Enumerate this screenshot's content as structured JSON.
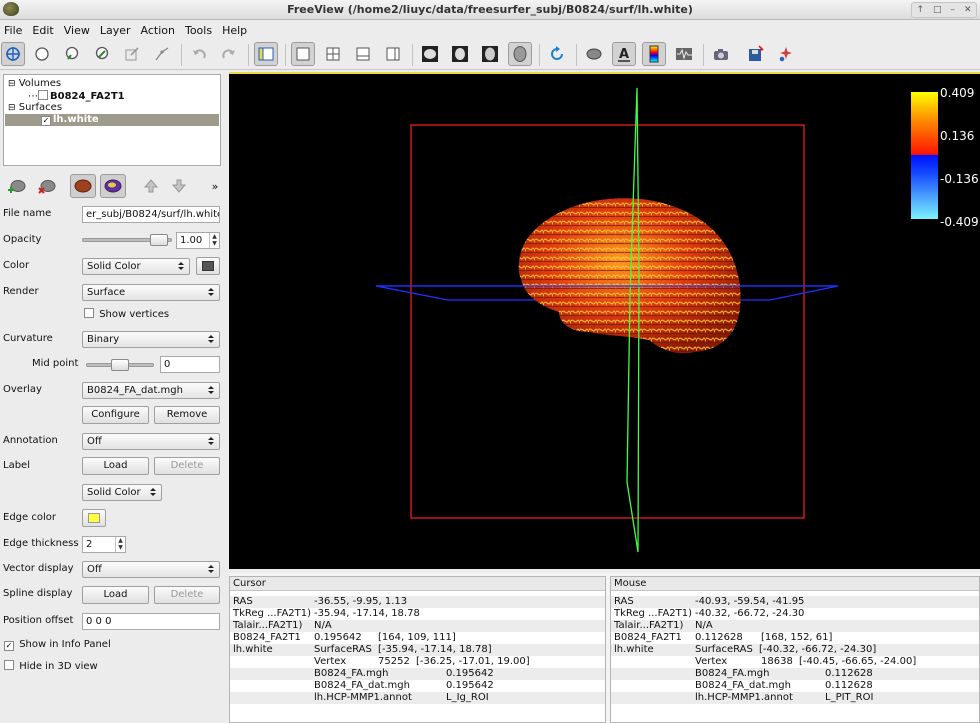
{
  "window": {
    "title": "FreeView (/home2/liuyc/data/freesurfer_subj/B0824/surf/lh.white)"
  },
  "menu": [
    "File",
    "Edit",
    "View",
    "Layer",
    "Action",
    "Tools",
    "Help"
  ],
  "layers": {
    "volumes_label": "Volumes",
    "volume_item": "B0824_FA2T1",
    "surfaces_label": "Surfaces",
    "surface_item": "lh.white"
  },
  "props": {
    "file_name_label": "File name",
    "file_name_value": "er_subj/B0824/surf/lh.white",
    "opacity_label": "Opacity",
    "opacity_value": "1.00",
    "opacity_level": 0.95,
    "color_label": "Color",
    "color_mode": "Solid Color",
    "render_label": "Render",
    "render_value": "Surface",
    "show_vertices": "Show vertices",
    "curvature_label": "Curvature",
    "curvature_value": "Binary",
    "midpoint_label": "Mid point",
    "midpoint_value": "0",
    "midpoint_level": 0.5,
    "overlay_label": "Overlay",
    "overlay_value": "B0824_FA_dat.mgh",
    "configure_btn": "Configure",
    "remove_btn": "Remove",
    "annotation_label": "Annotation",
    "annotation_value": "Off",
    "label_label": "Label",
    "load_btn": "Load",
    "delete_btn": "Delete",
    "label_color_mode": "Solid Color",
    "edge_color_label": "Edge color",
    "edge_thickness_label": "Edge thickness",
    "edge_thickness_value": "2",
    "vector_label": "Vector display",
    "vector_value": "Off",
    "spline_label": "Spline display",
    "spline_load": "Load",
    "spline_delete": "Delete",
    "position_label": "Position offset",
    "position_value": "0 0 0",
    "show_info": "Show in Info Panel",
    "hide_3d": "Hide in 3D view"
  },
  "colors": {
    "accent_yellow": "#e8d84c",
    "edge_color_swatch": "#ffff44",
    "frame_red": "#ff2020",
    "axis_green": "#40ff40",
    "axis_blue": "#2030ff"
  },
  "colorbar": {
    "max": "0.409",
    "high": "0.136",
    "low": "-0.136",
    "min": "-0.409"
  },
  "cursor_panel": {
    "header": "Cursor",
    "ras_label": "RAS",
    "ras": "-36.55, -9.95, 1.13",
    "tkreg_label": "TkReg ...FA2T1)",
    "tkreg": "-35.94, -17.14, 18.78",
    "talair_label": "Talair...FA2T1)",
    "talair": "N/A",
    "vol_label": "B0824_FA2T1",
    "vol_val": "0.195642",
    "vol_idx": "[164, 109, 111]",
    "surf_label": "lh.white",
    "sras_label": "SurfaceRAS",
    "sras": "[-35.94, -17.14, 18.78]",
    "vertex_label": "Vertex",
    "vertex_num": "75252",
    "vertex_coords": "[-36.25, -17.01, 19.00]",
    "ov1_label": "B0824_FA.mgh",
    "ov1": "0.195642",
    "ov2_label": "B0824_FA_dat.mgh",
    "ov2": "0.195642",
    "annot_label": "lh.HCP-MMP1.annot",
    "annot": "L_Ig_ROI"
  },
  "mouse_panel": {
    "header": "Mouse",
    "ras_label": "RAS",
    "ras": "-40.93, -59.54, -41.95",
    "tkreg_label": "TkReg ...FA2T1)",
    "tkreg": "-40.32, -66.72, -24.30",
    "talair_label": "Talair...FA2T1)",
    "talair": "N/A",
    "vol_label": "B0824_FA2T1",
    "vol_val": "0.112628",
    "vol_idx": "[168, 152, 61]",
    "surf_label": "lh.white",
    "sras_label": "SurfaceRAS",
    "sras": "[-40.32, -66.72, -24.30]",
    "vertex_label": "Vertex",
    "vertex_num": "18638",
    "vertex_coords": "[-40.45, -66.65, -24.00]",
    "ov1_label": "B0824_FA.mgh",
    "ov1": "0.112628",
    "ov2_label": "B0824_FA_dat.mgh",
    "ov2": "0.112628",
    "annot_label": "lh.HCP-MMP1.annot",
    "annot": "L_PIT_ROI"
  }
}
